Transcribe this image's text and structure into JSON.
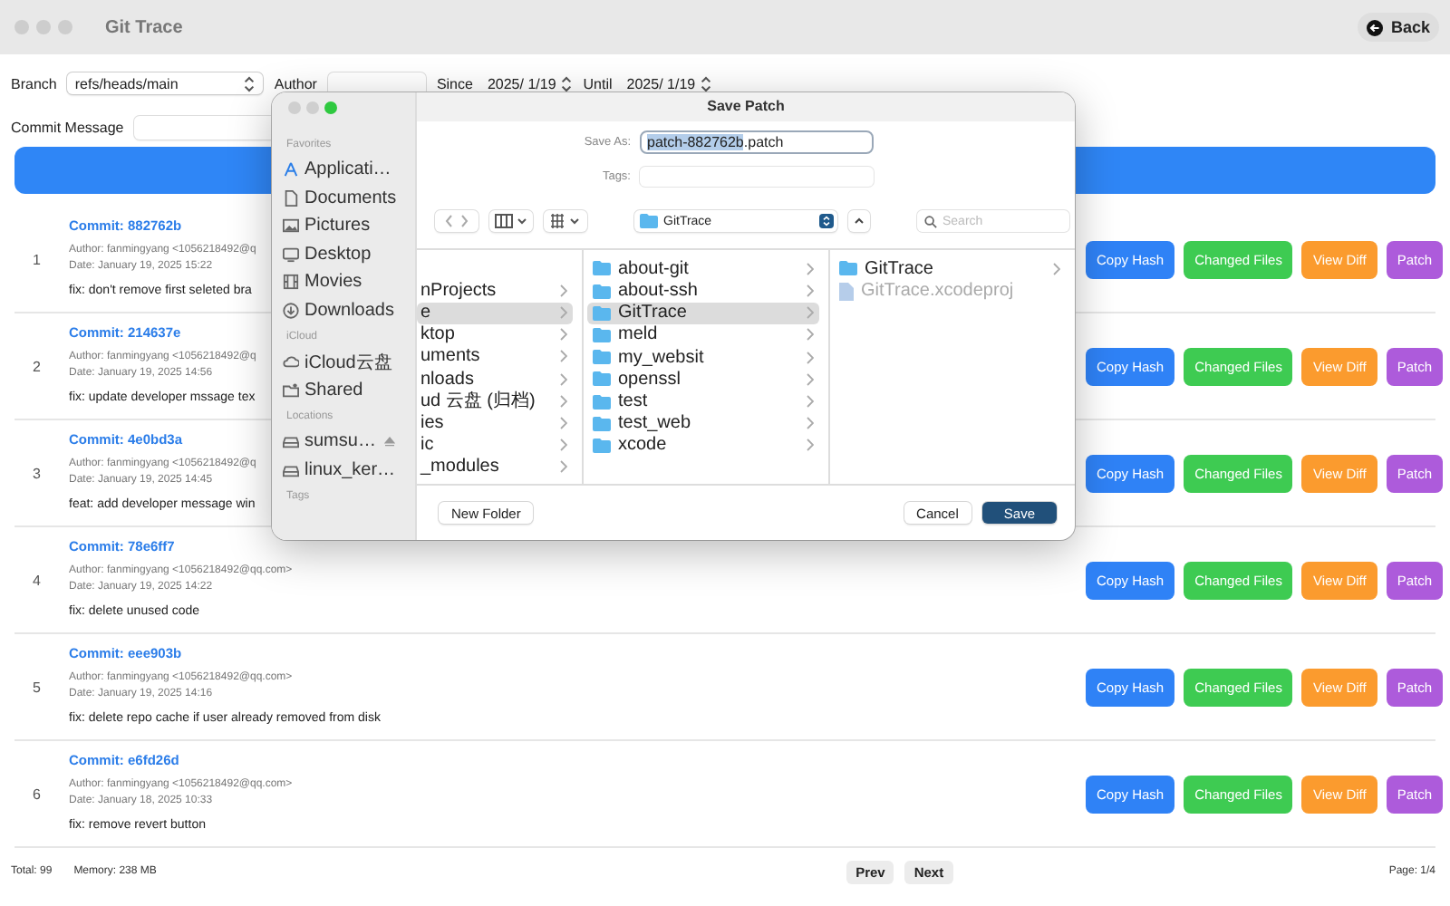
{
  "window": {
    "title": "Git Trace",
    "back_button": "Back"
  },
  "filters": {
    "branch": {
      "label": "Branch",
      "value": "refs/heads/main"
    },
    "author": {
      "label": "Author"
    },
    "since": {
      "label": "Since",
      "value": "2025/ 1/19"
    },
    "until": {
      "label": "Until",
      "value": "2025/ 1/19"
    },
    "commit_message": {
      "label": "Commit Message"
    }
  },
  "commits": [
    {
      "index": "1",
      "commit": "Commit: 882762b",
      "author": "Author: fanmingyang <1056218492@q",
      "date": "Date: January 19, 2025 15:22",
      "message": "fix: don't remove first seleted bra",
      "actions": [
        {
          "label": "Copy Hash",
          "color": "#2f82f6"
        },
        {
          "label": "Changed Files",
          "color": "#3ecb52"
        },
        {
          "label": "View Diff",
          "color": "#fb9b2e"
        },
        {
          "label": "Patch",
          "color": "#ad5bdb"
        }
      ]
    },
    {
      "index": "2",
      "commit": "Commit: 214637e",
      "author": "Author: fanmingyang <1056218492@q",
      "date": "Date: January 19, 2025 14:56",
      "message": "fix: update developer mssage tex",
      "actions": [
        {
          "label": "Copy Hash",
          "color": "#2f82f6"
        },
        {
          "label": "Changed Files",
          "color": "#3ecb52"
        },
        {
          "label": "View Diff",
          "color": "#fb9b2e"
        },
        {
          "label": "Patch",
          "color": "#ad5bdb"
        }
      ]
    },
    {
      "index": "3",
      "commit": "Commit: 4e0bd3a",
      "author": "Author: fanmingyang <1056218492@q",
      "date": "Date: January 19, 2025 14:45",
      "message": "feat: add developer message win",
      "actions": [
        {
          "label": "Copy Hash",
          "color": "#2f82f6"
        },
        {
          "label": "Changed Files",
          "color": "#3ecb52"
        },
        {
          "label": "View Diff",
          "color": "#fb9b2e"
        },
        {
          "label": "Patch",
          "color": "#ad5bdb"
        }
      ]
    },
    {
      "index": "4",
      "commit": "Commit: 78e6ff7",
      "author": "Author: fanmingyang <1056218492@qq.com>",
      "date": "Date: January 19, 2025 14:22",
      "message": "fix: delete unused code",
      "actions": [
        {
          "label": "Copy Hash",
          "color": "#2f82f6"
        },
        {
          "label": "Changed Files",
          "color": "#3ecb52"
        },
        {
          "label": "View Diff",
          "color": "#fb9b2e"
        },
        {
          "label": "Patch",
          "color": "#ad5bdb"
        }
      ]
    },
    {
      "index": "5",
      "commit": "Commit: eee903b",
      "author": "Author: fanmingyang <1056218492@qq.com>",
      "date": "Date: January 19, 2025 14:16",
      "message": "fix: delete repo cache if user already removed from disk",
      "actions": [
        {
          "label": "Copy Hash",
          "color": "#2f82f6"
        },
        {
          "label": "Changed Files",
          "color": "#3ecb52"
        },
        {
          "label": "View Diff",
          "color": "#fb9b2e"
        },
        {
          "label": "Patch",
          "color": "#ad5bdb"
        }
      ]
    },
    {
      "index": "6",
      "commit": "Commit: e6fd26d",
      "author": "Author: fanmingyang <1056218492@qq.com>",
      "date": "Date: January 18, 2025 10:33",
      "message": "fix: remove revert button",
      "actions": [
        {
          "label": "Copy Hash",
          "color": "#2f82f6"
        },
        {
          "label": "Changed Files",
          "color": "#3ecb52"
        },
        {
          "label": "View Diff",
          "color": "#fb9b2e"
        },
        {
          "label": "Patch",
          "color": "#ad5bdb"
        }
      ]
    }
  ],
  "footer": {
    "total": "Total: 99",
    "memory": "Memory: 238 MB",
    "prev": "Prev",
    "next": "Next",
    "page": "Page: 1/4"
  },
  "dialog": {
    "title": "Save Patch",
    "sidebar": [
      {
        "title": "Favorites",
        "items": [
          {
            "label": "Applicati…",
            "kind": "apps"
          },
          {
            "label": "Documents",
            "kind": "doc"
          },
          {
            "label": "Pictures",
            "kind": "pictures"
          },
          {
            "label": "Desktop",
            "kind": "desktop"
          },
          {
            "label": "Movies",
            "kind": "movies"
          },
          {
            "label": "Downloads",
            "kind": "downloads"
          }
        ]
      },
      {
        "title": "iCloud",
        "items": [
          {
            "label": "iCloud云盘",
            "kind": "cloud"
          },
          {
            "label": "Shared",
            "kind": "shared"
          }
        ]
      },
      {
        "title": "Locations",
        "items": [
          {
            "label": "sumsu…",
            "kind": "drive",
            "ejectable": true
          },
          {
            "label": "linux_ker…",
            "kind": "drive",
            "ejectable": false
          }
        ]
      },
      {
        "title": "Tags"
      }
    ],
    "save_as": {
      "label": "Save As:",
      "value_parts": [
        {
          "text": "patch-882762b",
          "selected": true
        },
        {
          "text": ".patch",
          "selected": false
        }
      ]
    },
    "tags": {
      "label": "Tags:"
    },
    "path": "GitTrace",
    "search": {
      "placeholder": "Search"
    },
    "columns": [
      {
        "items": [
          {
            "label": "nProjects",
            "selected": false,
            "has_children": true
          },
          {
            "label": "e",
            "selected": true,
            "has_children": true
          },
          {
            "label": "ktop",
            "selected": false,
            "has_children": true
          },
          {
            "label": "uments",
            "selected": false,
            "has_children": true
          },
          {
            "label": "nloads",
            "selected": false,
            "has_children": true
          },
          {
            "label": "ud 云盘 (归档)",
            "selected": false,
            "has_children": true
          },
          {
            "label": "ies",
            "selected": false,
            "has_children": true
          },
          {
            "label": "ic",
            "selected": false,
            "has_children": true
          },
          {
            "label": "_modules",
            "selected": false,
            "has_children": true
          }
        ]
      },
      {
        "items": [
          {
            "label": "about-git",
            "kind": "folder",
            "selected": false,
            "has_children": true
          },
          {
            "label": "about-ssh",
            "kind": "folder",
            "selected": false,
            "has_children": true
          },
          {
            "label": "GitTrace",
            "kind": "folder",
            "selected": true,
            "has_children": true
          },
          {
            "label": "meld",
            "kind": "folder",
            "selected": false,
            "has_children": true
          },
          {
            "label": "my_websit",
            "kind": "folder",
            "selected": false,
            "has_children": true
          },
          {
            "label": "openssl",
            "kind": "folder",
            "selected": false,
            "has_children": true
          },
          {
            "label": "test",
            "kind": "folder",
            "selected": false,
            "has_children": true
          },
          {
            "label": "test_web",
            "kind": "folder",
            "selected": false,
            "has_children": true
          },
          {
            "label": "xcode",
            "kind": "folder",
            "selected": false,
            "has_children": true
          }
        ]
      },
      {
        "items": [
          {
            "label": "GitTrace",
            "kind": "folder",
            "selected": false,
            "has_children": true,
            "disabled": false
          },
          {
            "label": "GitTrace.xcodeproj",
            "kind": "file",
            "selected": false,
            "has_children": false,
            "disabled": true
          }
        ]
      }
    ],
    "buttons": {
      "new_folder": "New Folder",
      "cancel": "Cancel",
      "save": "Save"
    }
  }
}
